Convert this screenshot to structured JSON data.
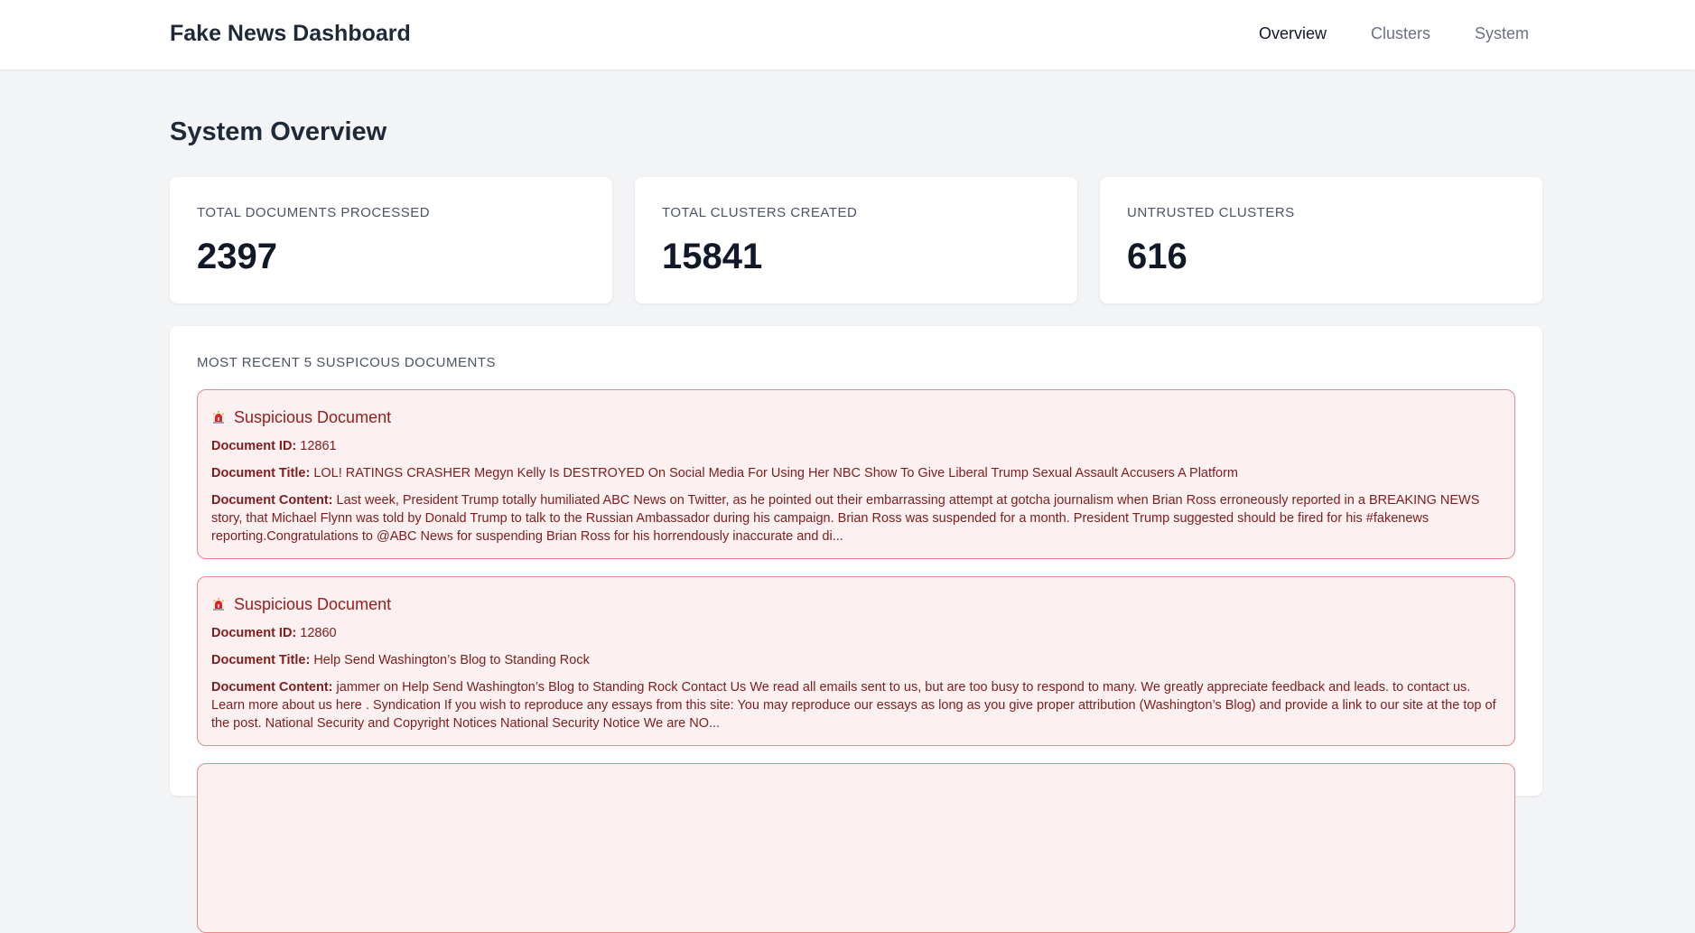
{
  "header": {
    "brand": "Fake News Dashboard",
    "nav": [
      {
        "label": "Overview",
        "active": true
      },
      {
        "label": "Clusters",
        "active": false
      },
      {
        "label": "System",
        "active": false
      }
    ]
  },
  "page": {
    "title": "System Overview"
  },
  "stats": [
    {
      "label": "TOTAL DOCUMENTS PROCESSED",
      "value": "2397"
    },
    {
      "label": "TOTAL CLUSTERS CREATED",
      "value": "15841"
    },
    {
      "label": "UNTRUSTED CLUSTERS",
      "value": "616"
    }
  ],
  "recent": {
    "heading": "MOST RECENT 5 SUSPICOUS DOCUMENTS",
    "id_label": "Document ID:",
    "title_label": "Document Title:",
    "content_label": "Document Content:",
    "items": [
      {
        "icon": "siren-icon",
        "heading": "Suspicious Document",
        "id": "12861",
        "title": "LOL! RATINGS CRASHER Megyn Kelly Is DESTROYED On Social Media For Using Her NBC Show To Give Liberal Trump Sexual Assault Accusers A Platform",
        "content": "Last week, President Trump totally humiliated ABC News on Twitter, as he pointed out their embarrassing attempt at gotcha journalism when Brian Ross erroneously reported in a BREAKING NEWS story, that Michael Flynn was told by Donald Trump to talk to the Russian Ambassador during his campaign. Brian Ross was suspended for a month. President Trump suggested should be fired for his #fakenews reporting.Congratulations to @ABC News for suspending Brian Ross for his horrendously inaccurate and di..."
      },
      {
        "icon": "siren-icon",
        "heading": "Suspicious Document",
        "id": "12860",
        "title": "Help Send Washington’s Blog to Standing Rock",
        "content": "jammer on Help Send Washington’s Blog to Standing Rock Contact Us We read all emails sent to us, but are too busy to respond to many. We greatly appreciate feedback and leads. to contact us. Learn more about us here . Syndication If you wish to reproduce any essays from this site: You may reproduce our essays as long as you give proper attribution (Washington’s Blog) and provide a link to our site at the top of the post. National Security and Copyright Notices National Security Notice We are NO..."
      }
    ]
  }
}
